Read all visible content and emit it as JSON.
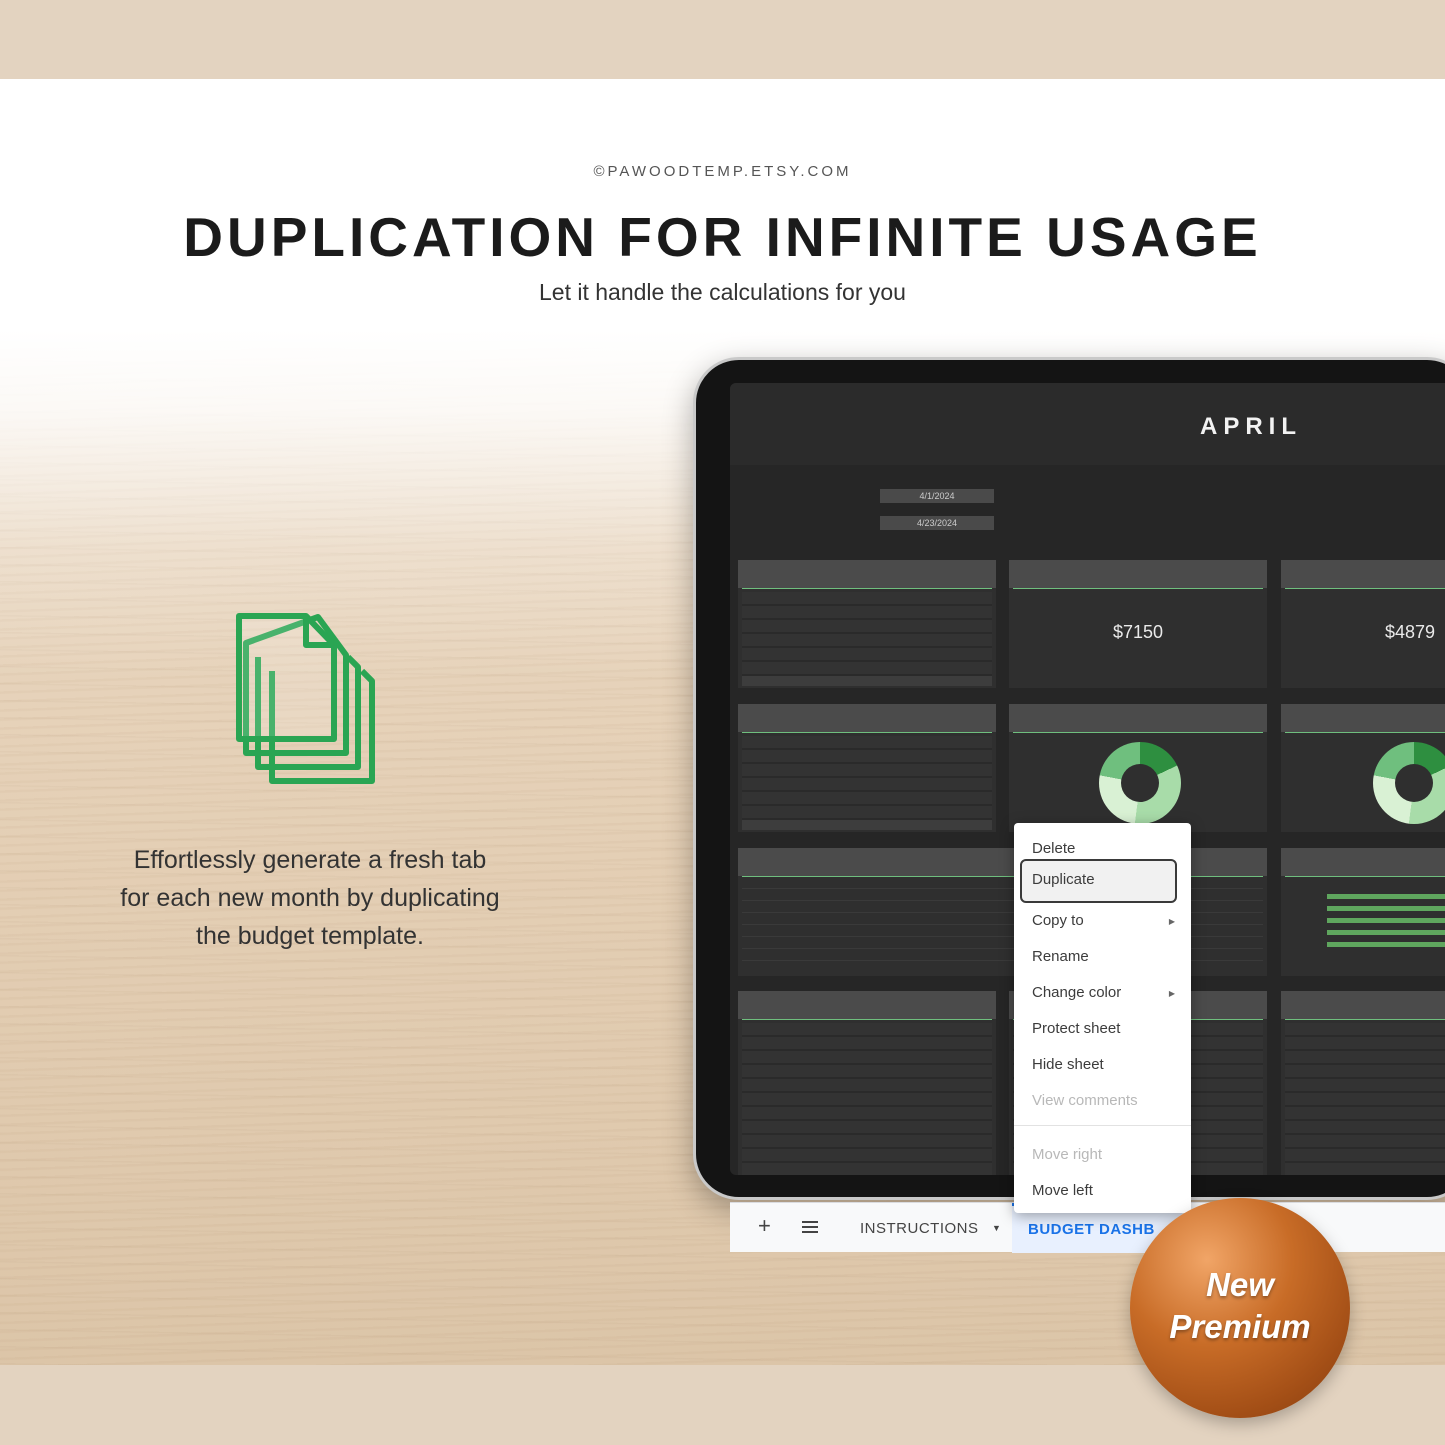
{
  "copyright": "©PAWOODTEMP.ETSY.COM",
  "headline": "DUPLICATION FOR INFINITE USAGE",
  "subline": "Let it handle the calculations for you",
  "description": {
    "line1": "Effortlessly generate a fresh tab",
    "line2": "for each new month by duplicating",
    "line3": "the budget template."
  },
  "dashboard": {
    "month": "APRIL",
    "start_date": "4/1/2024",
    "end_date": "4/23/2024",
    "total_income": "$7150",
    "total_expenses": "$4879",
    "accent_color": "#6fbf7e"
  },
  "context_menu": {
    "items": [
      {
        "label": "Delete",
        "state": "normal"
      },
      {
        "label": "Duplicate",
        "state": "selected"
      },
      {
        "label": "Copy to",
        "state": "normal",
        "submenu": true
      },
      {
        "label": "Rename",
        "state": "normal"
      },
      {
        "label": "Change color",
        "state": "normal",
        "submenu": true
      },
      {
        "label": "Protect sheet",
        "state": "normal"
      },
      {
        "label": "Hide sheet",
        "state": "normal"
      },
      {
        "label": "View comments",
        "state": "disabled"
      },
      {
        "label": "Move right",
        "state": "disabled"
      },
      {
        "label": "Move left",
        "state": "normal"
      }
    ]
  },
  "tabbar": {
    "add_icon": "plus-icon",
    "list_icon": "list-icon",
    "tab_instructions": "INSTRUCTIONS",
    "tab_active": "BUDGET DASHB",
    "active_color": "#1a73e8"
  },
  "badge": {
    "line1": "New",
    "line2": "Premium",
    "color": "#b45a1c"
  },
  "icon": "copy-documents-icon"
}
